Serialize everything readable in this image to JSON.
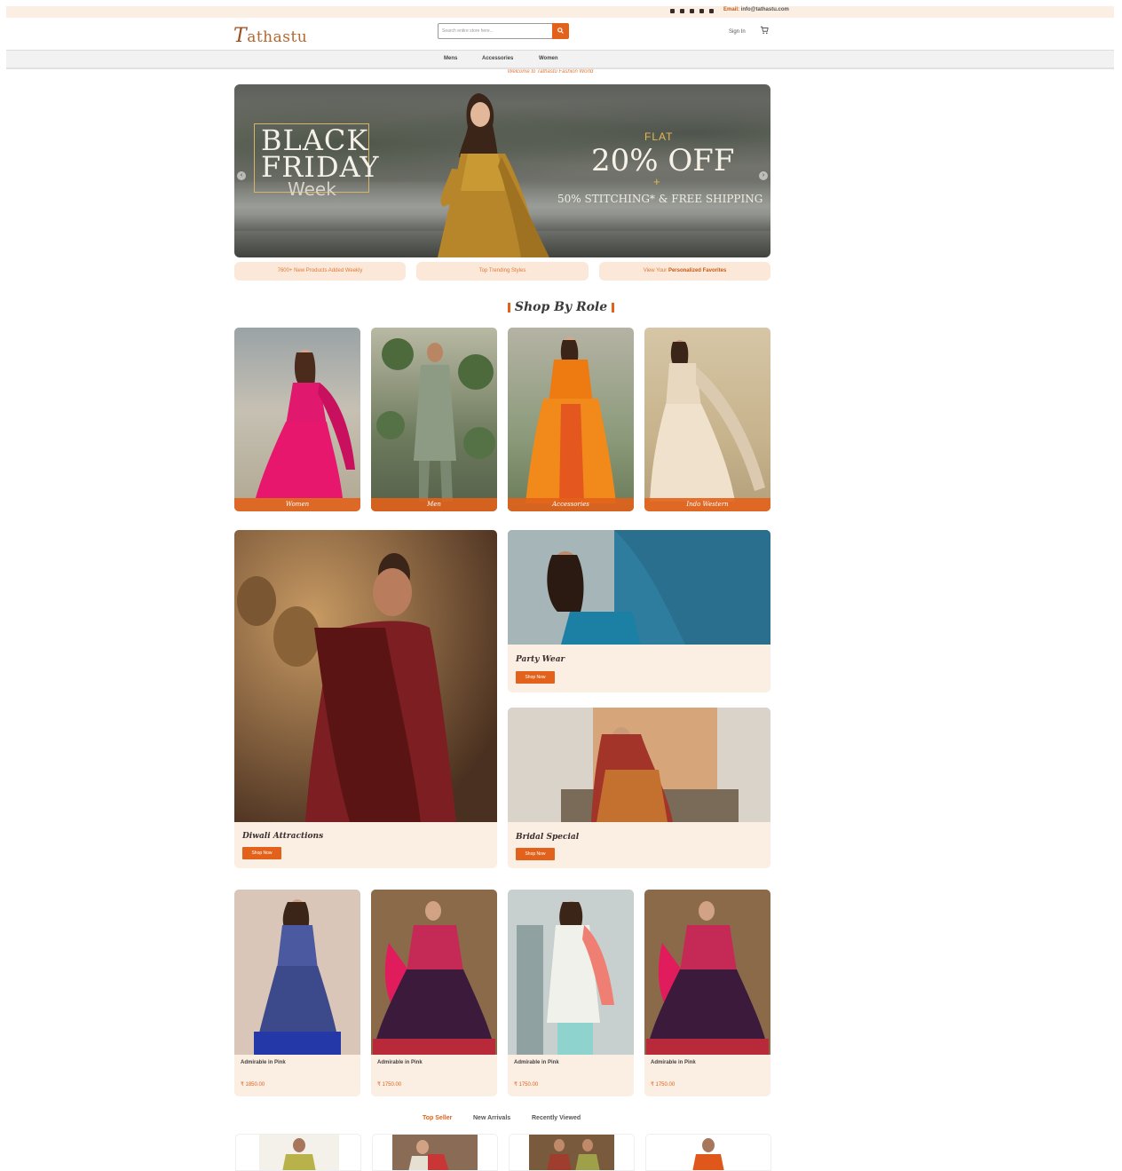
{
  "colors": {
    "accent": "#e2621b",
    "cream": "#fbeee3",
    "logo": "#b5672f"
  },
  "topbar": {
    "email_label": "Email:",
    "email": "info@tathastu.com"
  },
  "header": {
    "logo_initial": "T",
    "logo_rest": "athastu",
    "search_placeholder": "Search entire store here...",
    "search_icon": "search-icon",
    "signin": "Sign In",
    "cart_icon": "cart-icon"
  },
  "nav": {
    "items": [
      "Mens",
      "Accessories",
      "Women"
    ]
  },
  "welcome": "Welcome to Tathastu Fashion World",
  "hero": {
    "line1": "BLACK",
    "line2": "FRIDAY",
    "line3": "Week",
    "flat": "FLAT",
    "offer": "20% OFF",
    "plus": "+",
    "extra": "50% STITCHING* & FREE SHIPPING",
    "prev_icon": "chevron-left-icon",
    "next_icon": "chevron-right-icon"
  },
  "features": [
    {
      "prefix": "",
      "highlight": "",
      "text": "7600+ New Products Added Weekly"
    },
    {
      "prefix": "",
      "highlight": "",
      "text": "Top Trending Styles"
    },
    {
      "prefix": "View Your ",
      "highlight": "Personalized Favorites",
      "text": ""
    }
  ],
  "shop_by_role": {
    "title": "Shop By Role",
    "roles": [
      "Women",
      "Men",
      "Accessories",
      "Indo Western"
    ]
  },
  "promos": {
    "diwali": {
      "title": "Diwali Attractions",
      "button": "Shop Now"
    },
    "party": {
      "title": "Party Wear",
      "button": "Shop Now"
    },
    "bridal": {
      "title": "Bridal Special",
      "button": "Shop Now"
    }
  },
  "products": [
    {
      "name": "Admirable in Pink",
      "price": "₹ 1850.00"
    },
    {
      "name": "Admirable in Pink",
      "price": "₹ 1750.00"
    },
    {
      "name": "Admirable in Pink",
      "price": "₹ 1750.00"
    },
    {
      "name": "Admirable in Pink",
      "price": "₹ 1750.00"
    }
  ],
  "tabs": [
    "Top Seller",
    "New Arrivals",
    "Recently Viewed"
  ]
}
